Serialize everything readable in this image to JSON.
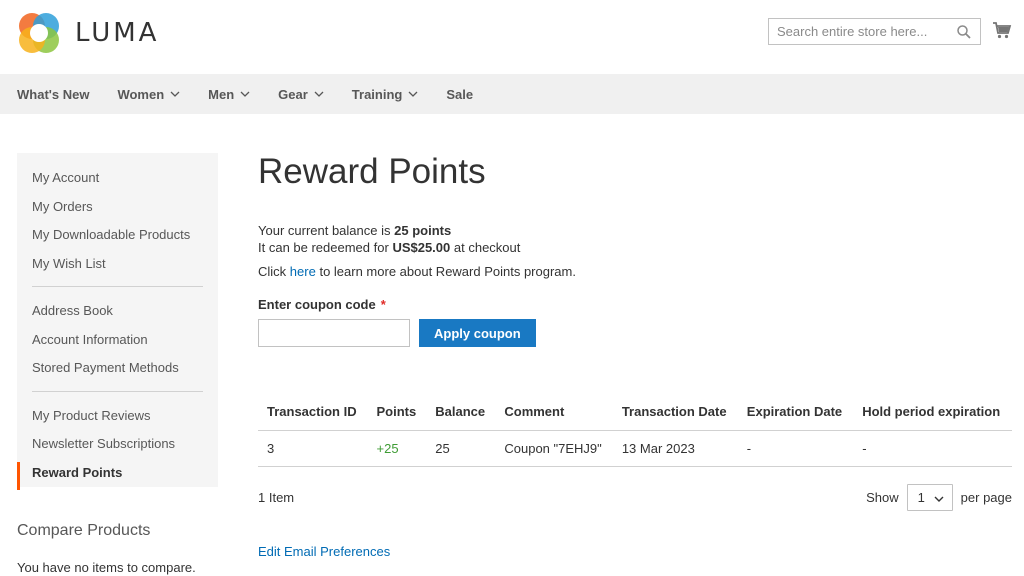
{
  "header": {
    "logo_text": "LUMA",
    "search_placeholder": "Search entire store here...",
    "accent_color": "#1979c3"
  },
  "nav": {
    "items": [
      {
        "label": "What's New",
        "has_dropdown": false
      },
      {
        "label": "Women",
        "has_dropdown": true
      },
      {
        "label": "Men",
        "has_dropdown": true
      },
      {
        "label": "Gear",
        "has_dropdown": true
      },
      {
        "label": "Training",
        "has_dropdown": true
      },
      {
        "label": "Sale",
        "has_dropdown": false
      }
    ]
  },
  "sidebar": {
    "groups": [
      [
        "My Account",
        "My Orders",
        "My Downloadable Products",
        "My Wish List"
      ],
      [
        "Address Book",
        "Account Information",
        "Stored Payment Methods"
      ],
      [
        "My Product Reviews",
        "Newsletter Subscriptions",
        "Reward Points"
      ]
    ],
    "active": "Reward Points"
  },
  "compare": {
    "title": "Compare Products",
    "empty_text": "You have no items to compare."
  },
  "main": {
    "title": "Reward Points",
    "balance_prefix": "Your current balance is",
    "balance_value": "25 points",
    "redeem_prefix": "It can be redeemed for",
    "redeem_value": "US$25.00",
    "redeem_suffix": "at checkout",
    "learn_prefix": "Click",
    "learn_link": "here",
    "learn_suffix": "to learn more about Reward Points program.",
    "coupon_label": "Enter coupon code",
    "required_mark": "*",
    "coupon_value": "",
    "apply_label": "Apply coupon",
    "table": {
      "headers": [
        "Transaction ID",
        "Points",
        "Balance",
        "Comment",
        "Transaction Date",
        "Expiration Date",
        "Hold period expiration"
      ],
      "rows": [
        [
          "3",
          "+25",
          "25",
          "Coupon \"7EHJ9\"",
          "13 Mar 2023",
          "-",
          "-"
        ]
      ]
    },
    "items_count": "1 Item",
    "show_label": "Show",
    "limiter_value": "1",
    "per_page_label": "per page",
    "edit_email_label": "Edit Email Preferences"
  }
}
